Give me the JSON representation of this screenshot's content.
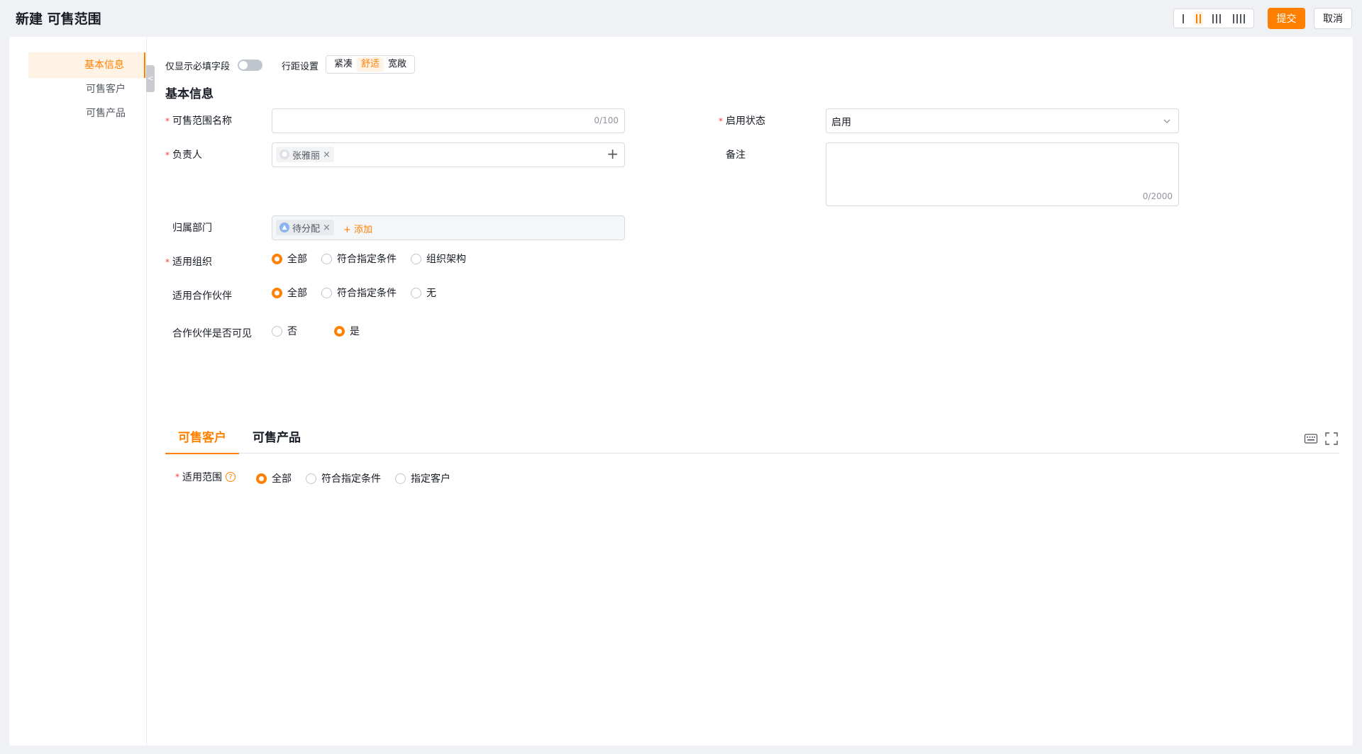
{
  "header": {
    "title": "新建 可售范围",
    "submit_label": "提交",
    "cancel_label": "取消"
  },
  "sidebar": {
    "items": [
      {
        "label": "基本信息",
        "active": true
      },
      {
        "label": "可售客户",
        "active": false
      },
      {
        "label": "可售产品",
        "active": false
      }
    ]
  },
  "toolbar": {
    "required_only_label": "仅显示必填字段",
    "required_only_on": false,
    "spacing_label": "行距设置",
    "spacing_options": [
      "紧凑",
      "舒适",
      "宽敞"
    ],
    "spacing_selected": "舒适"
  },
  "basic": {
    "section_title": "基本信息",
    "name": {
      "label": "可售范围名称",
      "value": "",
      "counter": "0/100"
    },
    "status": {
      "label": "启用状态",
      "value": "启用"
    },
    "owner": {
      "label": "负责人",
      "tag": "张雅丽"
    },
    "remark": {
      "label": "备注",
      "value": "",
      "counter": "0/2000"
    },
    "department": {
      "label": "归属部门",
      "tag": "待分配",
      "add_label": "+ 添加"
    },
    "org": {
      "label": "适用组织",
      "options": [
        "全部",
        "符合指定条件",
        "组织架构"
      ],
      "selected": "全部"
    },
    "partner": {
      "label": "适用合作伙伴",
      "options": [
        "全部",
        "符合指定条件",
        "无"
      ],
      "selected": "全部"
    },
    "partner_visible": {
      "label": "合作伙伴是否可见",
      "options": [
        "否",
        "是"
      ],
      "selected": "是"
    }
  },
  "tabs": {
    "items": [
      "可售客户",
      "可售产品"
    ],
    "active": "可售客户"
  },
  "scope": {
    "label": "适用范围",
    "help": "?",
    "options": [
      "全部",
      "符合指定条件",
      "指定客户"
    ],
    "selected": "全部"
  },
  "colors": {
    "accent": "#ff8000",
    "required": "#ff3b30"
  }
}
